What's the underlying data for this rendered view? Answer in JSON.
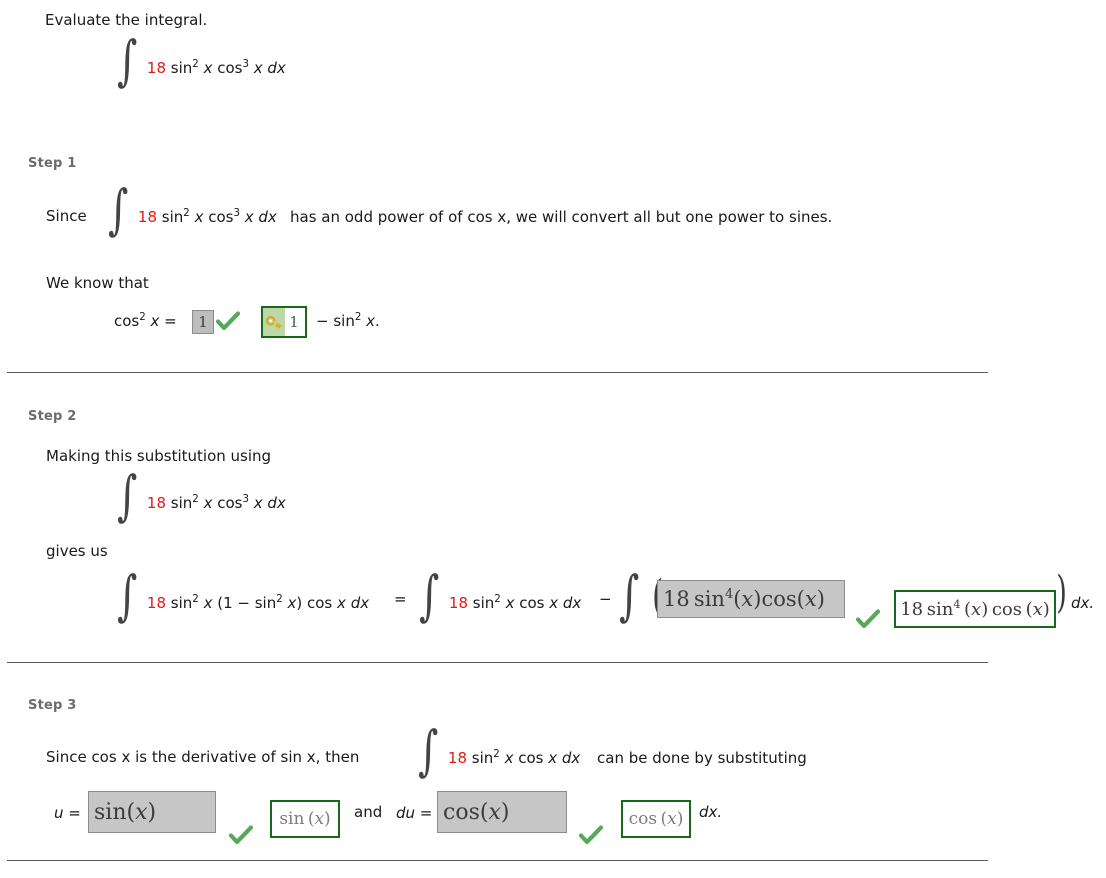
{
  "page": {
    "title": "Evaluate the integral.",
    "problem_integral": {
      "coefficient": "18",
      "expression": "sin2 x cos3 x dx",
      "plain": "∫ 18 sin^2 x cos^3 x dx"
    }
  },
  "colors": {
    "coefficient_red": "#e01b1b",
    "step_label_gray": "#6b6b6b",
    "answer_box_fill": "#c6c6c6",
    "answer_box_border": "#8c8c8c",
    "key_border_green": "#186a18",
    "key_pane_green": "#bcd8a8",
    "check_green": "#57a957",
    "key_gold": "#e8c34a",
    "divider_gray": "#585858"
  },
  "steps": [
    {
      "label": "Step 1",
      "since_word": "Since",
      "integral_coef": "18",
      "integral_tail": "sin2 x cos3 x dx",
      "after_integral": "has an odd power of of cos x, we will convert all but one power to sines.",
      "we_know_that": "We know that",
      "identity_lhs": "cos2 x =",
      "identity_tail": "− sin2 x.",
      "answer_1": {
        "value": "1",
        "correct": true
      },
      "key_1": {
        "value": "1"
      }
    },
    {
      "label": "Step 2",
      "lead_in": "Making this substitution using",
      "integral_coef": "18",
      "integral_tail": "sin2 x cos3 x dx",
      "gives_us": "gives us",
      "lhs_coef": "18",
      "lhs_tail": "sin2 x (1 − sin2 x) cos x dx",
      "equals": "=",
      "mid_coef": "18",
      "mid_tail": "sin2 x cos x dx",
      "minus": "−",
      "answer_2": {
        "value": "18 sin4(x)cos(x)",
        "correct": true
      },
      "key_2": {
        "value": "18 sin4 (x) cos (x)"
      },
      "trailing": "dx."
    },
    {
      "label": "Step 3",
      "since_text_a": "Since  cos x  is the derivative of  sin x,  then",
      "integral_coef": "18",
      "integral_tail": "sin2 x cos x dx",
      "after_integral": "can be done by substituting",
      "u_label": "u =",
      "answer_u": {
        "value": "sin(x)",
        "correct": true
      },
      "key_u": {
        "value": "sin (x)"
      },
      "and_word": "and",
      "du_label": "du =",
      "answer_du": {
        "value": "cos(x)",
        "correct": true
      },
      "key_du": {
        "value": "cos (x)"
      },
      "trailing": "dx."
    }
  ],
  "icons": {
    "check": "check-icon",
    "key": "key-icon"
  }
}
